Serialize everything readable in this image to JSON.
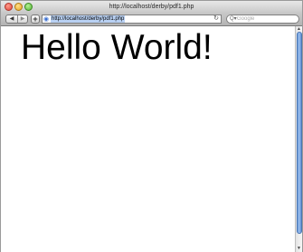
{
  "window": {
    "title": "http://localhost/derby/pdf1.php"
  },
  "toolbar": {
    "back_icon": "◀",
    "forward_icon": "▶",
    "add_icon": "+",
    "site_icon": "◉",
    "url": "http://localhost/derby/pdf1.php",
    "reload_icon": "↻",
    "search_icon": "Q▾",
    "search_placeholder": "Google"
  },
  "page": {
    "heading": "Hello World!"
  },
  "scrollbar": {
    "up_icon": "▲",
    "down_icon": "▼"
  },
  "colors": {
    "url_highlight": "#b9d1f3",
    "scroll_thumb": "#7fa8e2"
  }
}
